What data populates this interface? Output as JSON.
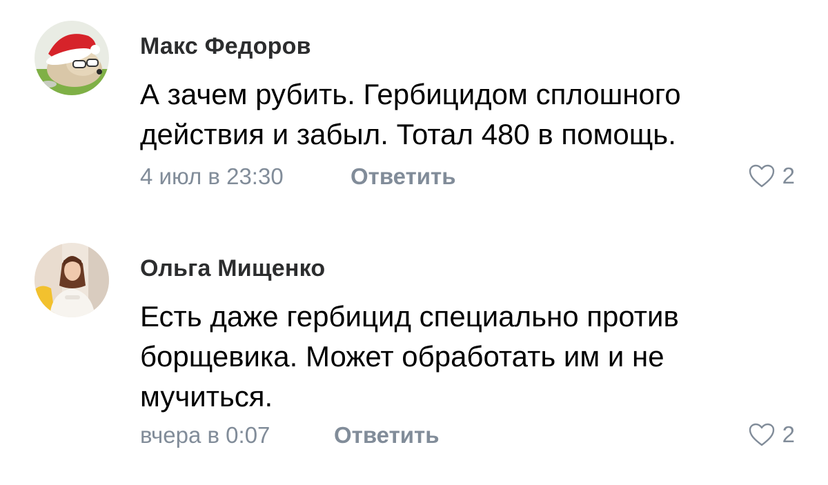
{
  "comments": [
    {
      "author": "Макс Федоров",
      "text": "А зачем рубить. Гербицидом сплошного\nдействия и забыл. Тотал 480 в помощь.",
      "timestamp": "4 июл в 23:30",
      "reply_label": "Ответить",
      "likes": "2",
      "like_icon": "heart-outline-icon",
      "avatar": "avatar-dog-santa-hat"
    },
    {
      "author": "Ольга Мищенко",
      "text": "Есть даже гербицид специально против\nборщевика. Может обработать им и не\nмучиться.",
      "timestamp": "вчера в 0:07",
      "reply_label": "Ответить",
      "likes": "2",
      "like_icon": "heart-outline-icon",
      "avatar": "avatar-woman-photo"
    }
  ],
  "colors": {
    "name": "#2c2d2e",
    "text": "#000000",
    "secondary": "#818c99",
    "background": "#ffffff"
  }
}
